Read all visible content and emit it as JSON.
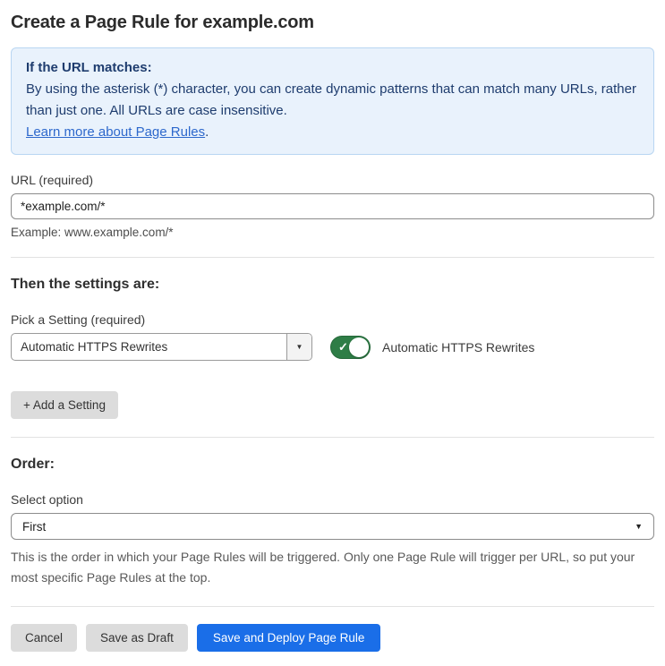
{
  "page": {
    "title": "Create a Page Rule for example.com"
  },
  "info_box": {
    "heading": "If the URL matches:",
    "body": "By using the asterisk (*) character, you can create dynamic patterns that can match many URLs, rather than just one. All URLs are case insensitive.",
    "link_label": "Learn more about Page Rules",
    "link_suffix": "."
  },
  "url_field": {
    "label": "URL (required)",
    "value": "*example.com/*",
    "example": "Example: www.example.com/*"
  },
  "settings": {
    "heading": "Then the settings are:",
    "pick_label": "Pick a Setting (required)",
    "selected_setting": "Automatic HTTPS Rewrites",
    "dropdown_arrow": "▼",
    "toggle": {
      "state": "on",
      "checkmark": "✓",
      "label": "Automatic HTTPS Rewrites"
    },
    "add_setting_label": "+ Add a Setting"
  },
  "order": {
    "heading": "Order:",
    "select_label": "Select option",
    "selected_option": "First",
    "dropdown_arrow": "▼",
    "help_text": "This is the order in which your Page Rules will be triggered. Only one Page Rule will trigger per URL, so put your most specific Page Rules at the top."
  },
  "footer": {
    "cancel_label": "Cancel",
    "save_draft_label": "Save as Draft",
    "save_deploy_label": "Save and Deploy Page Rule"
  },
  "colors": {
    "info_background": "#e9f2fc",
    "info_border": "#b9d6f2",
    "info_text": "#1e3c6e",
    "link": "#2d68cc",
    "toggle_on": "#2e7d46",
    "primary_button": "#1a6ee8",
    "secondary_button": "#dcdcdc"
  }
}
